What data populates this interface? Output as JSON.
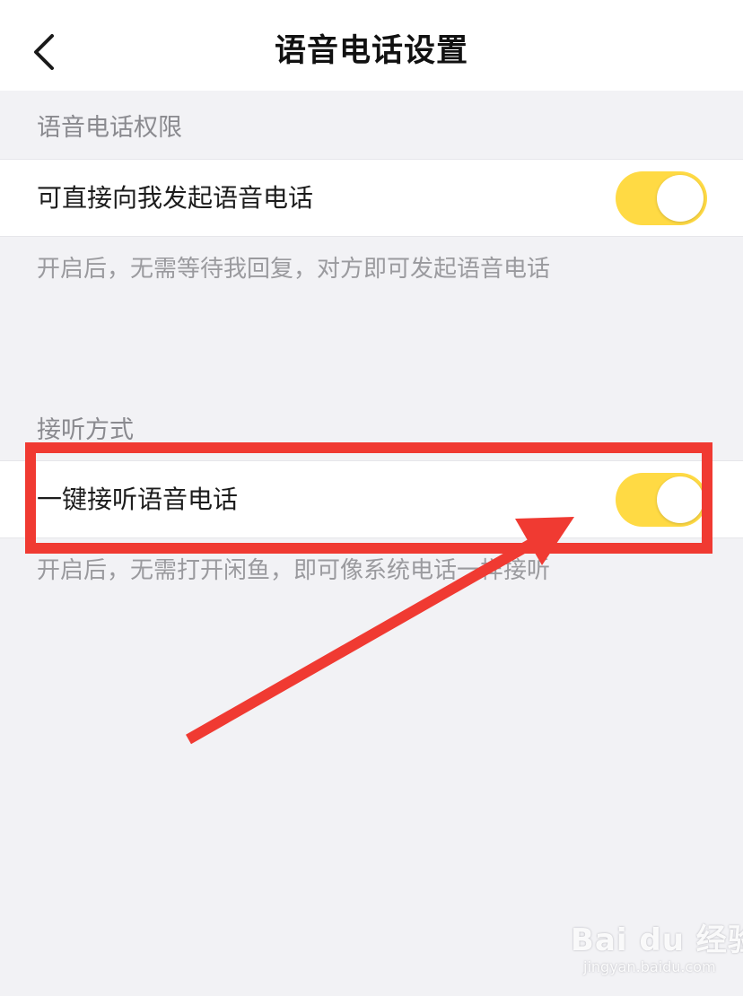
{
  "nav": {
    "title": "语音电话设置",
    "back_icon": "chevron-left-icon"
  },
  "permission_section": {
    "header": "语音电话权限",
    "row_label": "可直接向我发起语音电话",
    "toggle_on": true,
    "hint": "开启后，无需等待我回复，对方即可发起语音电话"
  },
  "answer_section": {
    "header": "接听方式",
    "row_label": "一键接听语音电话",
    "toggle_on": true,
    "hint": "开启后，无需打开闲鱼，即可像系统电话一样接听"
  },
  "colors": {
    "toggle_on": "#ffda44",
    "annotation": "#f03a32",
    "background": "#f2f2f5"
  },
  "watermark": {
    "brand": "Bai du 经验",
    "url": "jingyan.baidu.com"
  }
}
